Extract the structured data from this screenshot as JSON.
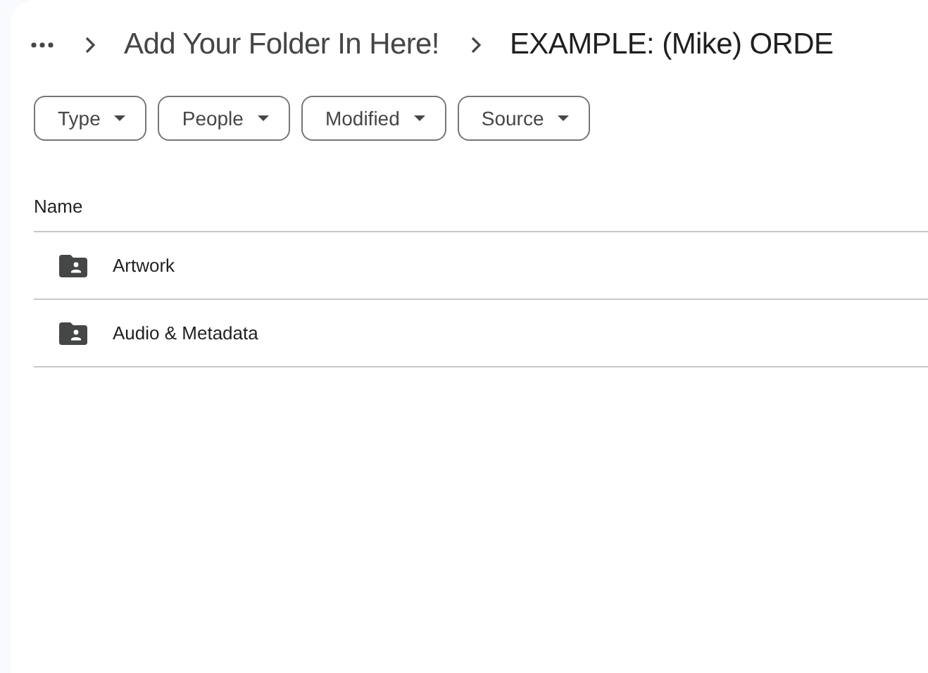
{
  "breadcrumbs": [
    "Add Your Folder In Here!",
    "EXAMPLE: (Mike) ORDE"
  ],
  "filters": [
    "Type",
    "People",
    "Modified",
    "Source"
  ],
  "table": {
    "columns": [
      "Name"
    ],
    "rows": [
      {
        "name": "Artwork",
        "kind": "shared-folder"
      },
      {
        "name": "Audio & Metadata",
        "kind": "shared-folder"
      }
    ]
  }
}
